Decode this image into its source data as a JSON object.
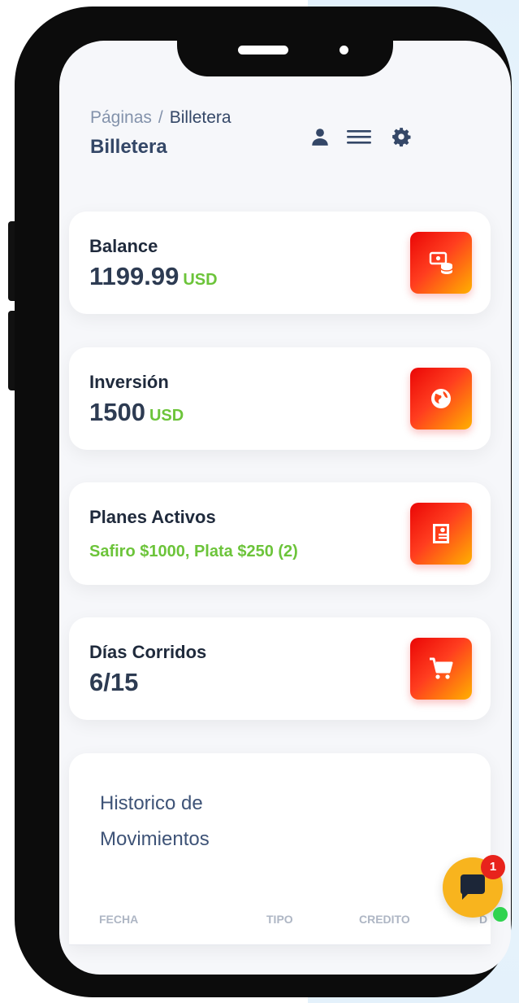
{
  "header": {
    "breadcrumb_root": "Páginas",
    "breadcrumb_separator": "/",
    "breadcrumb_current": "Billetera",
    "page_title": "Billetera",
    "icons": [
      "user-icon",
      "menu-icon",
      "gear-icon"
    ]
  },
  "cards": [
    {
      "label": "Balance",
      "value": "1199.99",
      "unit": "USD",
      "icon": "money-coins-icon"
    },
    {
      "label": "Inversión",
      "value": "1500",
      "unit": "USD",
      "icon": "world-icon"
    },
    {
      "label": "Planes Activos",
      "value": "Safiro $1000, Plata $250 (2)",
      "icon": "book-icon"
    },
    {
      "label": "Días Corridos",
      "value": "6/15",
      "icon": "cart-icon"
    }
  ],
  "history": {
    "title": "Historico de Movimientos",
    "columns": [
      "FECHA",
      "TIPO",
      "CREDITO",
      "D"
    ]
  },
  "chat": {
    "badge_count": "1",
    "icon": "chat-icon"
  },
  "colors": {
    "accent_gradient_start": "#ea0606",
    "accent_gradient_end": "#ffb100",
    "value_green": "#6cc43a",
    "text_dark": "#344767",
    "chat_bubble": "#f8b41e",
    "badge_red": "#e8231c",
    "online_green": "#2fd34f"
  }
}
